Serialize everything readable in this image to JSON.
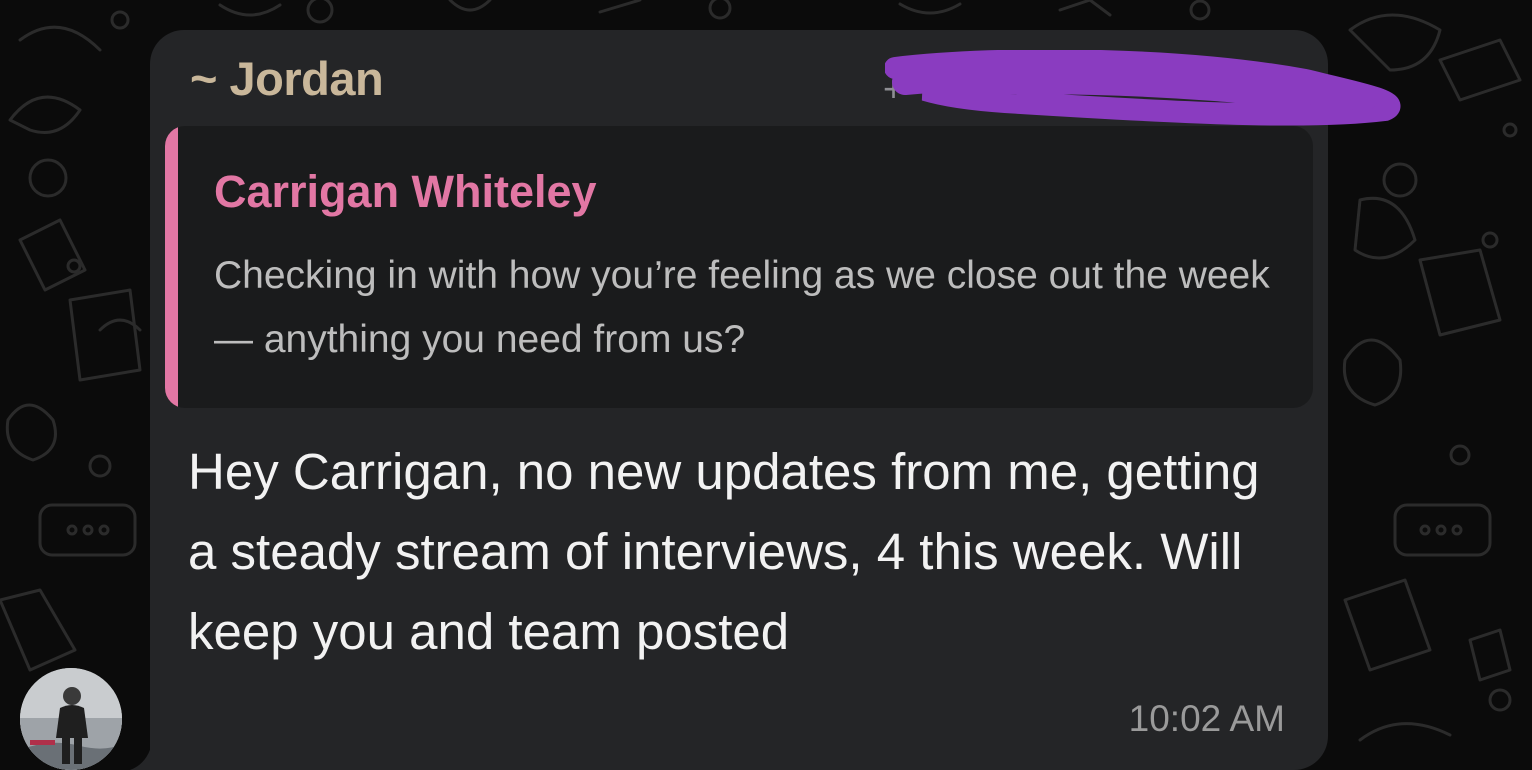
{
  "chat": {
    "sender": {
      "name": "~ Jordan",
      "phone_prefix": "+"
    },
    "quoted_message": {
      "author": "Carrigan Whiteley",
      "text": "Checking in with how you’re feeling as we close out the week — anything you need from us?"
    },
    "message": {
      "text": "Hey Carrigan, no new updates from me, getting a steady stream of interviews, 4 this week. Will keep you and team posted",
      "time": "10:02 AM"
    },
    "avatar_icon": "person-photo-avatar",
    "colors": {
      "bubble": "#242527",
      "sender_name": "#c9b79a",
      "quote_accent": "#e277a4",
      "redaction": "#8a3cc0",
      "wallpaper": "#0b0b0b"
    }
  }
}
